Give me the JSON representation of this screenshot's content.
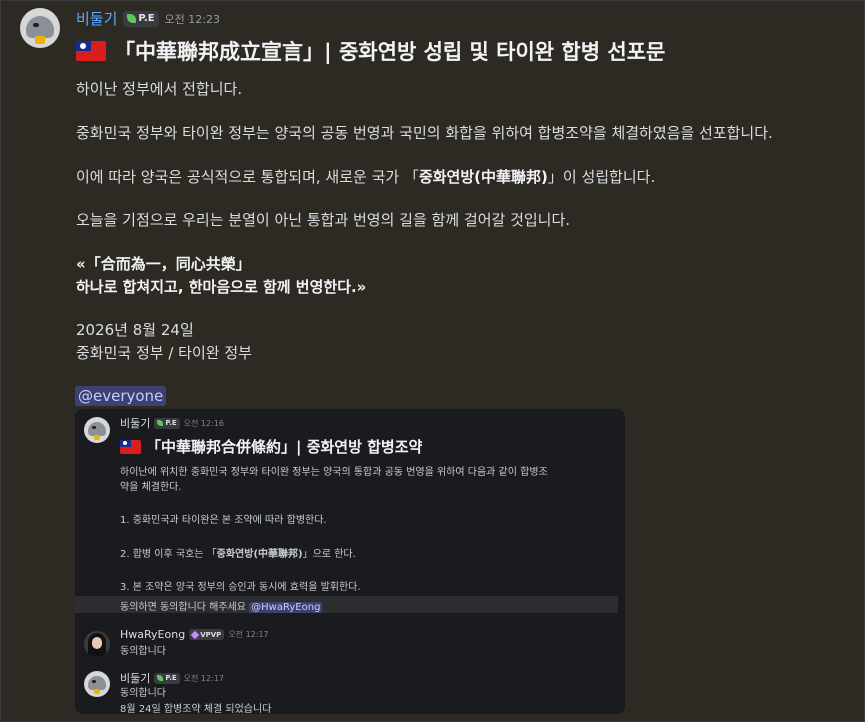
{
  "message": {
    "author": "비둘기",
    "badge": "P.E",
    "time": "오전 12:23",
    "title": "「中華聯邦成立宣言」| 중화연방 성립 및 타이완 합병 선포문",
    "flag_icon": "taiwan-flag",
    "paragraphs": {
      "p1": "하이난 정부에서 전합니다.",
      "p2": "중화민국 정부와 타이완 정부는 양국의 공동 번영과 국민의 화합을 위하여 합병조약을 체결하였음을 선포합니다.",
      "p3_before": "이에 따라 양국은 공식적으로 통합되며, 새로운 국가 「",
      "p3_bold": "중화연방(中華聯邦)",
      "p3_after": "」이 성립합니다.",
      "p4": "오늘을 기점으로 우리는 분열이 아닌 통합과 번영의 길을 함께 걸어갈 것입니다.",
      "quote1": "«「合而為一，同心共榮」",
      "quote2": "하나로 합쳐지고, 한마음으로 함께 번영한다.»",
      "date": "2026년 8월 24일",
      "signers": "중화민국 정부 / 타이완 정부"
    },
    "mention": "@everyone"
  },
  "embed": {
    "author": "비둘기",
    "badge": "P.E",
    "time": "오전 12:16",
    "title": "「中華聯邦合併條約」| 중화연방 합병조약",
    "line1": "하이난에 위치한 중화민국 정부와 타이완 정부는 양국의 통합과 공동 번영을 위하여 다음과 같이 합병조",
    "line2": "약을 체결한다.",
    "item1": "1. 중화민국과 타이완은 본 조약에 따라 합병한다.",
    "item2_before": "2. 합병 이후 국호는 「",
    "item2_bold": "중화연방(中華聯邦)",
    "item2_after": "」으로 한다.",
    "item3": "3. 본 조약은 양국 정부의 승인과 동시에 효력을 발휘한다.",
    "agree_text": "동의하면 동의합니다 해주세요",
    "agree_mention": "@HwaRyEong",
    "reply1": {
      "author": "HwaRyEong",
      "badge": "VPVP",
      "time": "오전 12:17",
      "text": "동의합니다"
    },
    "reply2": {
      "author": "비둘기",
      "badge": "P.E",
      "time": "오전 12:17",
      "text1": "동의합니다",
      "text2": "8월 24일 합병조약 체결 되었습니다"
    }
  },
  "colors": {
    "background": "#2d2a24",
    "username": "#5aa8ff",
    "mention_bg": "#3c4270",
    "embed_bg": "#1a1b1e"
  }
}
